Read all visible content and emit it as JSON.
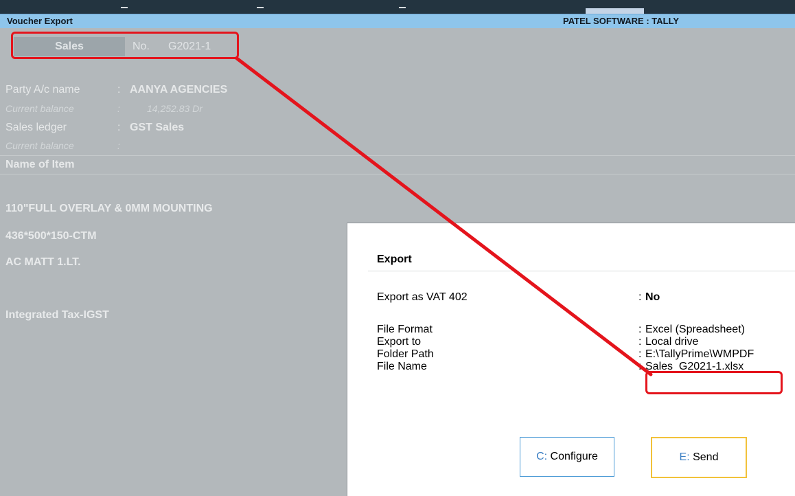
{
  "window": {
    "title": "Voucher Export",
    "company": "PATEL SOFTWARE : TALLY"
  },
  "voucher": {
    "type": "Sales",
    "no_label": "No.",
    "no_value": "G2021-1",
    "party_label": "Party A/c name",
    "party_value": "AANYA AGENCIES",
    "party_balance_label": "Current balance",
    "party_balance_value": "14,252.83 Dr",
    "sales_ledger_label": "Sales ledger",
    "sales_ledger_value": "GST Sales",
    "ledger_balance_label": "Current balance",
    "items_header": "Name of Item",
    "items": [
      "110\"FULL OVERLAY & 0MM MOUNTING",
      "436*500*150-CTM",
      "AC MATT 1.LT."
    ],
    "tax_ledger": "Integrated Tax-IGST"
  },
  "dialog": {
    "title": "Export",
    "fields": [
      {
        "label": "Export as VAT 402",
        "value": "No"
      },
      {
        "label": "File Format",
        "value": "Excel (Spreadsheet)"
      },
      {
        "label": "Export to",
        "value": "Local drive"
      },
      {
        "label": "Folder Path",
        "value": "E:\\TallyPrime\\WMPDF"
      },
      {
        "label": "File Name",
        "value": "Sales_G2021-1.xlsx"
      }
    ],
    "configure": {
      "key": "C:",
      "label": "Configure"
    },
    "send": {
      "key": "E:",
      "label": "Send"
    }
  },
  "colors": {
    "annotation": "#e4141c",
    "title_bar": "#8ec5eb",
    "send_border": "#f2c23a",
    "configure_border": "#4a9ad6"
  }
}
